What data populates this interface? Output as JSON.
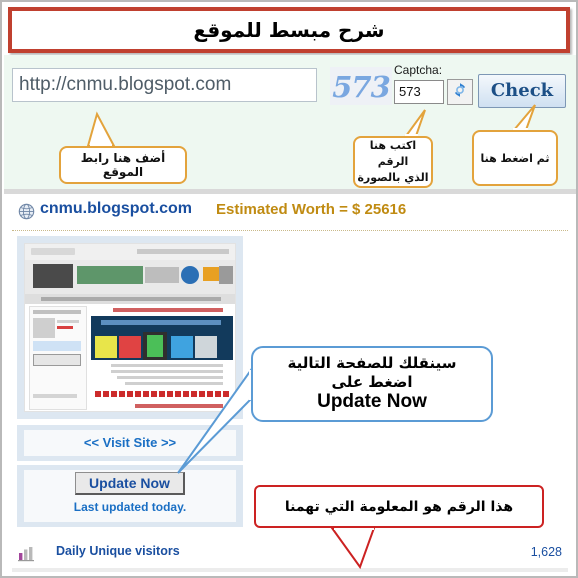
{
  "title": {
    "text": "شرح مبسط للموقع"
  },
  "form": {
    "url_value": "http://cnmu.blogspot.com",
    "url_placeholder": "http://",
    "captcha_image_text": "573",
    "captcha_label": "Captcha:",
    "captcha_value": "573",
    "refresh_icon": "refresh-icon",
    "check_label": "Check"
  },
  "callouts": {
    "url": "أضف هنا رابط الموقع",
    "captcha_line1": "اكتب هنا الرقم",
    "captcha_line2": "الذي بالصورة",
    "check": "ثم اضغط هنا",
    "update_line1": "سينقلك للصفحة التالية",
    "update_line2": "اضغط على",
    "update_line3": "Update Now",
    "number": "هذا الرقم هو المعلومة التي تهمنا"
  },
  "results": {
    "globe_icon": "globe-icon",
    "domain": "cnmu.blogspot.com",
    "estimated_worth": "Estimated Worth = $ 25616",
    "visit_site_label": "<< Visit Site >>",
    "update_now_label": "Update Now",
    "last_updated_label": "Last updated today.",
    "stats_icon": "bar-chart-icon",
    "stats_label": "Daily Unique visitors",
    "stats_value": "1,628"
  },
  "colors": {
    "title_border": "#c0402f",
    "band_bg": "#eef8f1",
    "callout_orange": "#e3a33c",
    "callout_blue": "#5b9bd5",
    "callout_red": "#cc2222",
    "link_blue": "#1a4fa0",
    "worth_gold": "#c08b12",
    "card_bg": "#dde7f1"
  }
}
